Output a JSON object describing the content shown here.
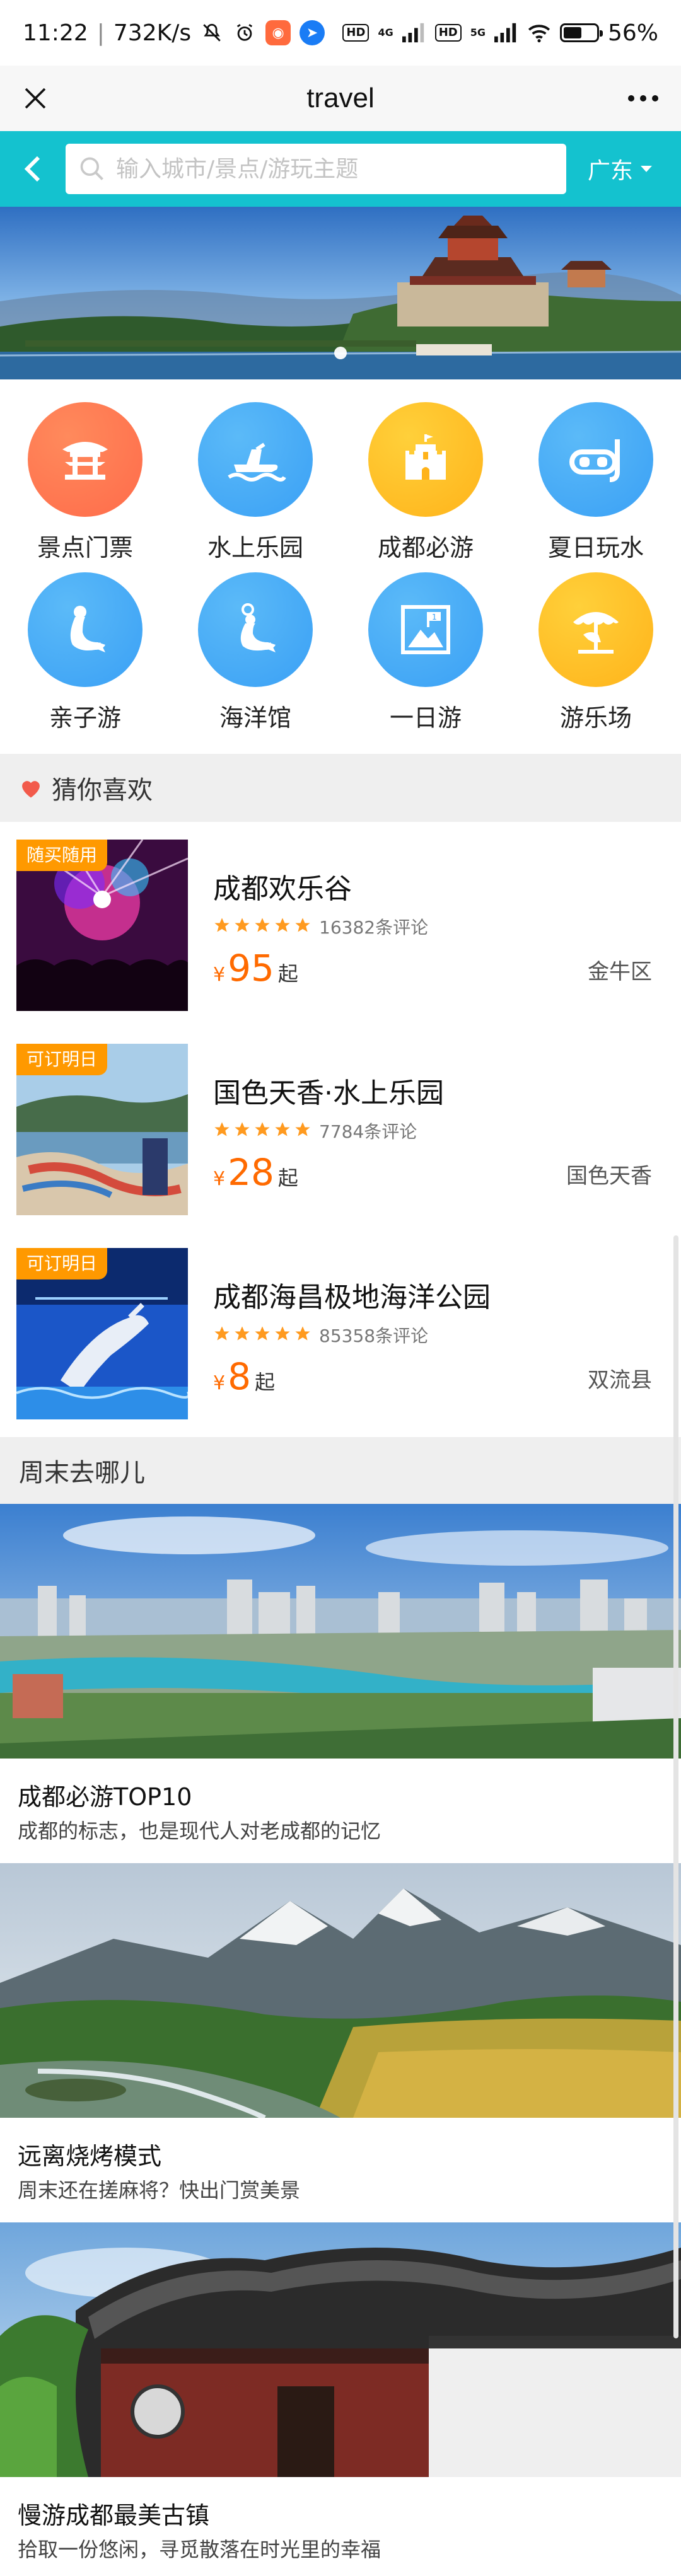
{
  "status_bar": {
    "time": "11:22",
    "speed": "732K/s",
    "net1": "4G",
    "net2": "5G",
    "hd": "HD",
    "battery": "56%",
    "battery_level": 0.56
  },
  "title_bar": {
    "title": "travel"
  },
  "search": {
    "placeholder": "输入城市/景点/游玩主题",
    "city": "广东"
  },
  "banner": {
    "active_index": 0
  },
  "categories": [
    {
      "label": "景点门票",
      "icon": "pavilion-icon",
      "color": "#ff6b4a"
    },
    {
      "label": "水上乐园",
      "icon": "jetski-icon",
      "color": "#3aa0f5"
    },
    {
      "label": "成都必游",
      "icon": "castle-icon",
      "color": "#ffb31a"
    },
    {
      "label": "夏日玩水",
      "icon": "snorkel-mask-icon",
      "color": "#3aa0f5"
    },
    {
      "label": "亲子游",
      "icon": "seal-icon",
      "color": "#3aa0f5"
    },
    {
      "label": "海洋馆",
      "icon": "seal-ball-icon",
      "color": "#3aa0f5"
    },
    {
      "label": "一日游",
      "icon": "mountain-flag-icon",
      "color": "#3aa0f5"
    },
    {
      "label": "游乐场",
      "icon": "carousel-icon",
      "color": "#ffb31a"
    }
  ],
  "guess_section": {
    "title": "猜你喜欢"
  },
  "recommendations": [
    {
      "badge": "随买随用",
      "name": "成都欢乐谷",
      "rating": 5,
      "reviews": "16382条评论",
      "currency": "¥",
      "price": "95",
      "price_suffix": "起",
      "area": "金牛区",
      "thumb": "concert"
    },
    {
      "badge": "可订明日",
      "name": "国色天香·水上乐园",
      "rating": 5,
      "reviews": "7784条评论",
      "currency": "¥",
      "price": "28",
      "price_suffix": "起",
      "area": "国色天香",
      "thumb": "lake"
    },
    {
      "badge": "可订明日",
      "name": "成都海昌极地海洋公园",
      "rating": 5,
      "reviews": "85358条评论",
      "currency": "¥",
      "price": "8",
      "price_suffix": "起",
      "area": "双流县",
      "thumb": "dolphin"
    }
  ],
  "weekend_section": {
    "title": "周末去哪儿"
  },
  "features": [
    {
      "title": "成都必游TOP10",
      "subtitle": "成都的标志，也是现代人对老成都的记忆"
    },
    {
      "title": "远离烧烤模式",
      "subtitle": "周末还在搓麻将？快出门赏美景"
    },
    {
      "title": "慢游成都最美古镇",
      "subtitle": "拾取一份悠闲，寻觅散落在时光里的幸福"
    }
  ],
  "colors": {
    "header_teal": "#14c2cf",
    "price_orange": "#ff6a00",
    "badge_orange": "#ff9900",
    "star_orange": "#ff9a1f",
    "heart_red": "#f25a4b"
  }
}
